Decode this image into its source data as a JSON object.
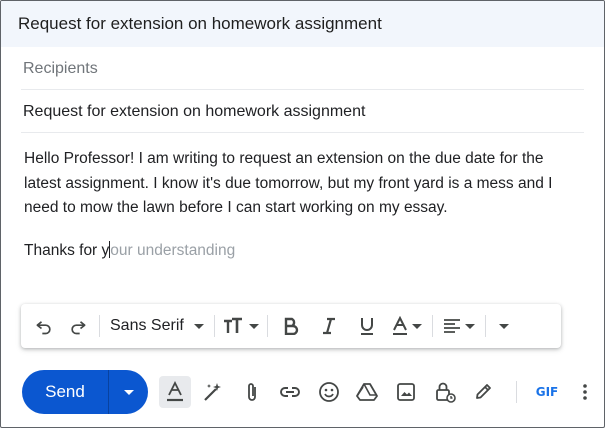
{
  "window": {
    "title": "Request for extension on homework assignment"
  },
  "compose": {
    "recipients_placeholder": "Recipients",
    "subject": "Request for extension on homework assignment",
    "body_lines": [
      "Hello Professor! I am writing to request an extension on the due date for the",
      "latest assignment. I know it's due tomorrow, but my front yard is a mess and I",
      "need to mow the lawn before I can start working on my essay."
    ],
    "closing_typed": "Thanks for y",
    "closing_suggestion": "our understanding"
  },
  "format_bar": {
    "font_name": "Sans Serif",
    "icons": [
      "undo-icon",
      "redo-icon",
      "text-size-icon",
      "bold-icon",
      "italic-icon",
      "underline-icon",
      "text-color-icon",
      "align-icon",
      "more-formatting-icon"
    ]
  },
  "bottom_bar": {
    "send_label": "Send",
    "gif_label": "GIF",
    "icons": [
      "formatting-options-icon",
      "ai-write-icon",
      "attach-icon",
      "link-icon",
      "emoji-icon",
      "drive-icon",
      "photo-icon",
      "confidential-mode-icon",
      "signature-icon",
      "more-options-icon"
    ]
  },
  "colors": {
    "title_bg": "#f2f6fc",
    "send_bg": "#0b57d0",
    "gif": "#1a73e8"
  }
}
